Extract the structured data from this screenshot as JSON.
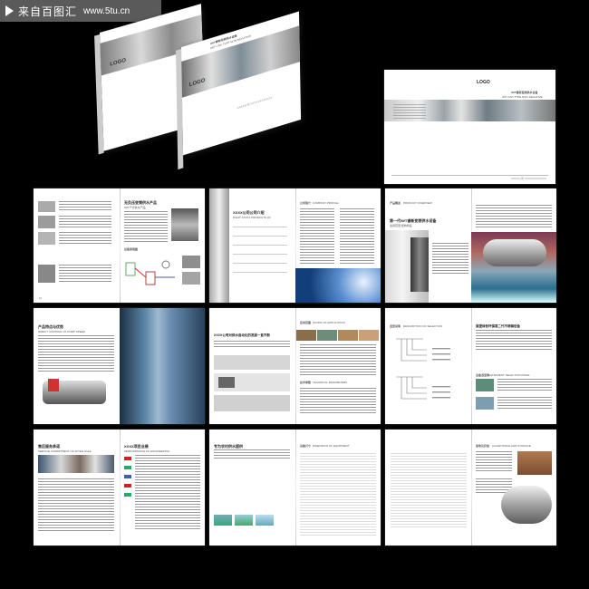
{
  "watermark": {
    "text": "来自百图汇",
    "url": "www.5tu.cn"
  },
  "cover": {
    "logo": "LOGO",
    "title_cn": "IWT睿新变频供水设备",
    "title_en": "IWT CAN TYPE NON-NEGATIVE",
    "footer": "XXXX公司  XXXXXXXXXXXX"
  },
  "spreads": {
    "s1": {
      "h1": "无负压变频供水产品",
      "h2": "IWT干式供水产品",
      "h3": "设备原理图",
      "pn": "01"
    },
    "s2": {
      "title": "XXXX公司公司介绍",
      "sub": "WHAT XXXXX PRODUCTS OF",
      "tag": "公司简介",
      "tag_en": "COMPANY PROFILE"
    },
    "s3": {
      "tag": "产品概述",
      "tag_en": "PRODUCT OVERVIEW",
      "title": "第一代IWT睿新变频供水设备",
      "sub": "适用范围  结构特征"
    },
    "s4": {
      "title": "产品特点与优势",
      "sub": "DIRECT CONTROL OF PUMP SPEED"
    },
    "s5": {
      "title": "XXXX公司对供水自动化的发展一直不断",
      "tag": "应用范围",
      "tag_en": "SCOPE OF APPLICATION",
      "tag2": "技术参数",
      "tag2_en": "TECHNICAL PARAMETERS"
    },
    "s6": {
      "tag": "选型说明",
      "tag_en": "DESCRIPTION OF SELECTION",
      "title": "展望绿色环保第二代不锈钢设备",
      "tag2": "设备选型表",
      "tag2_en": "EQUIPMENT SELECTION MODE"
    },
    "s7": {
      "title": "售后服务承诺",
      "sub": "SERVICE COMMITMENT OF AFTER SALE",
      "title2": "XXXX项目业绩",
      "sub2": "PERFORMANCE OF ENGINEERING"
    },
    "s8": {
      "title": "专为农村供水提供",
      "tag": "设备尺寸",
      "tag_en": "DIMENSION OF EQUIPMENT"
    },
    "s9": {
      "tag": "验收及存放",
      "tag_en": "ACCEPTANCE AND STORAGE"
    }
  },
  "colors": {
    "background": "#000000",
    "page": "#ffffff",
    "banner": "#5a5a5a"
  }
}
